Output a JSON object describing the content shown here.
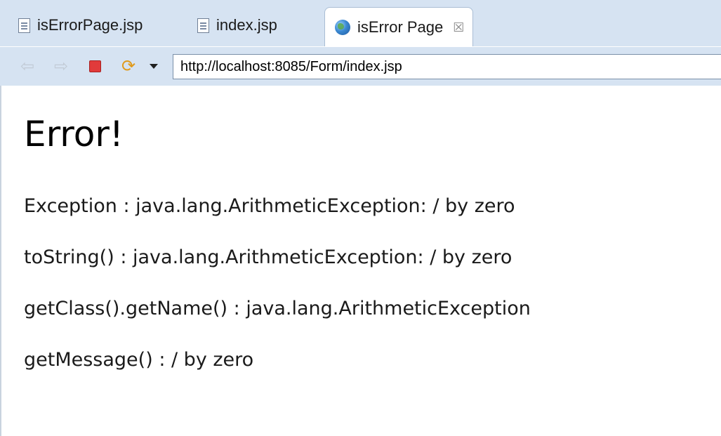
{
  "tabs": [
    {
      "label": "isErrorPage.jsp",
      "icon": "jsp-file-icon",
      "active": false
    },
    {
      "label": "index.jsp",
      "icon": "jsp-file-icon",
      "active": false
    },
    {
      "label": "isError Page",
      "icon": "globe-icon",
      "active": true,
      "close": "☒"
    }
  ],
  "toolbar": {
    "back": "⇦",
    "forward": "⇨",
    "refresh": "⟳",
    "url": "http://localhost:8085/Form/index.jsp"
  },
  "page": {
    "title": "Error!",
    "lines": [
      "Exception : java.lang.ArithmeticException: / by zero",
      "toString() : java.lang.ArithmeticException: / by zero",
      "getClass().getName() : java.lang.ArithmeticException",
      "getMessage() : / by zero"
    ]
  },
  "colors": {
    "chrome": "#d6e3f2",
    "stop": "#e13b3b",
    "refresh": "#e09a1c"
  }
}
